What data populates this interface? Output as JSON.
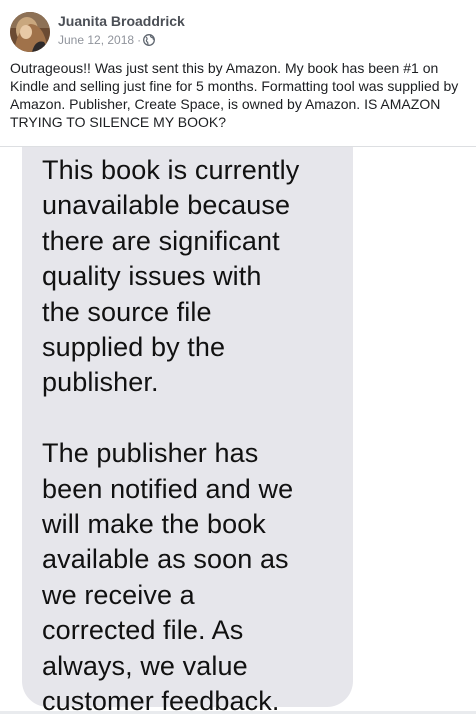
{
  "post": {
    "author": "Juanita Broaddrick",
    "date": "June 12, 2018",
    "separator": "·",
    "privacy_icon": "globe-icon",
    "text": "Outrageous!! Was just sent this by Amazon. My book has been #1 on\nKindle and selling just fine for 5 months. Formatting tool was supplied by\nAmazon. Publisher, Create Space, is owned by Amazon. IS AMAZON\nTRYING TO SILENCE MY BOOK?"
  },
  "photo": {
    "message_paragraph_1": "This book is currently\nunavailable because\nthere are significant\nquality issues with\nthe source file\nsupplied by the\npublisher.",
    "message_paragraph_2": "The publisher has\nbeen notified and we\nwill make the book\navailable as soon as\nwe receive a\ncorrected file. As\nalways, we value\ncustomer feedback."
  },
  "colors": {
    "author_name": "#4b4f56",
    "meta_text": "#90949c",
    "body_text": "#1c1e21",
    "bubble_background": "#e6e6eb"
  }
}
